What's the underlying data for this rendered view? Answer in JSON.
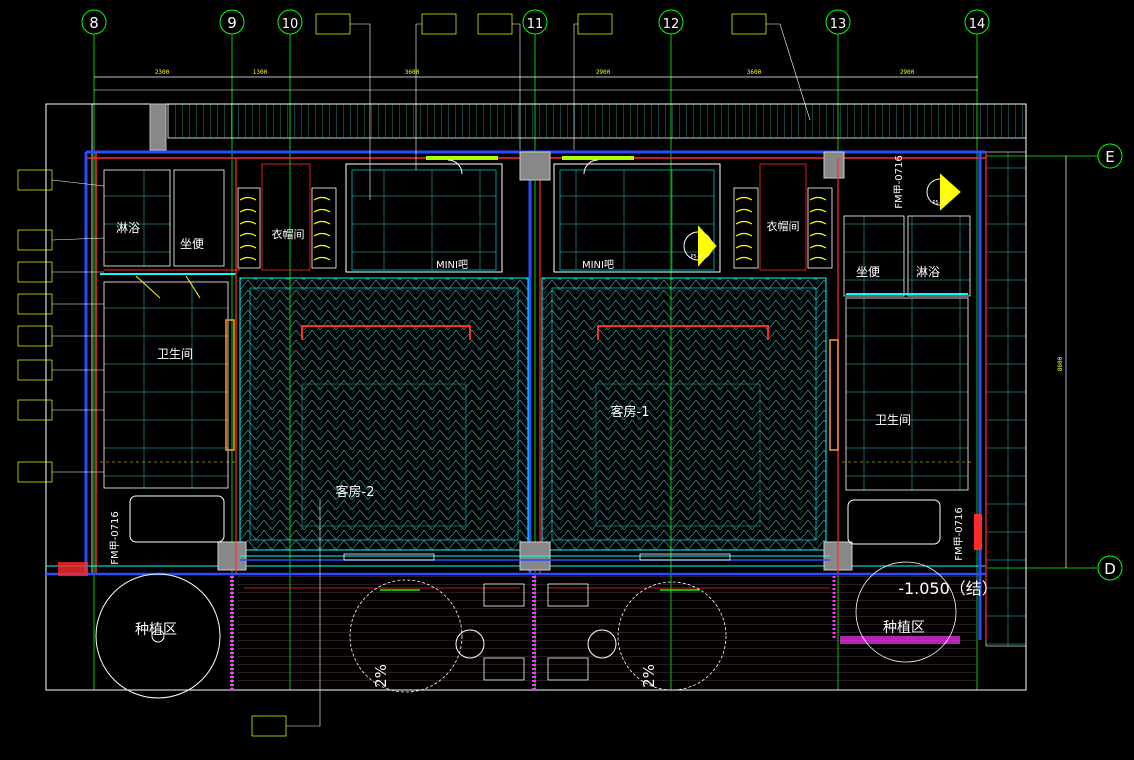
{
  "colors": {
    "background": "#000000",
    "grid_line": "#00ff00",
    "wall_red": "#ff2a2a",
    "wall_blue": "#2a4bff",
    "cyan": "#00ffff",
    "yellow": "#ffff00",
    "white": "#ffffff",
    "magenta": "#ff33ff",
    "wood": "#5fb8b8",
    "hatch": "#2fa0a0"
  },
  "axes": {
    "columns": [
      "8",
      "9",
      "10",
      "11",
      "12",
      "13",
      "14"
    ],
    "rows": [
      "E",
      "D"
    ]
  },
  "dimensions": {
    "top_segments": [
      "2300",
      "1300",
      "3600",
      "2900",
      "3600",
      "2900"
    ],
    "right_height": "8600"
  },
  "rooms": {
    "guest_room_1": "客房-1",
    "guest_room_2": "客房-2",
    "bathroom": "卫生间",
    "toilet": "坐便",
    "shower": "淋浴",
    "closet": "衣帽间",
    "minibar": "MINI吧",
    "planting": "种植区"
  },
  "elevation_note": "-1.050（结）",
  "slope": "2%",
  "section_tags": [
    "FM甲-0716",
    "FM甲-0716"
  ],
  "callouts": {
    "elev_left": "P5-01",
    "elev_right": "P5-02"
  }
}
